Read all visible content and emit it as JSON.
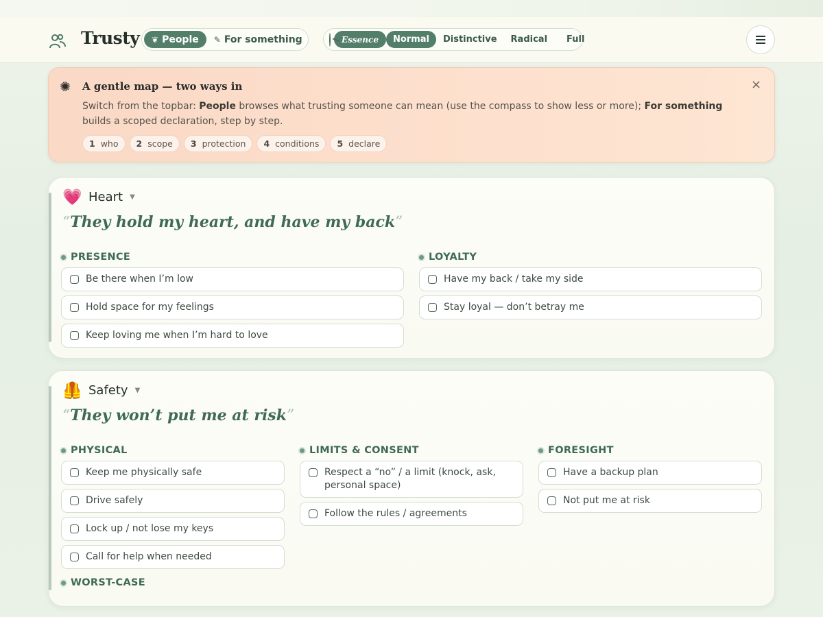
{
  "app": {
    "brand": "Trusty"
  },
  "modes": [
    {
      "label": "People",
      "glyph": "❦",
      "active": true
    },
    {
      "label": "For something",
      "glyph": "✎",
      "active": false
    }
  ],
  "levels": [
    {
      "label": "Essence",
      "active": true,
      "style": "italic"
    },
    {
      "label": "Normal",
      "active": true
    },
    {
      "label": "Distinctive",
      "active": false
    },
    {
      "label": "Radical",
      "active": false
    },
    {
      "label": "Full",
      "active": false
    }
  ],
  "banner": {
    "icon": "✺",
    "title": "A gentle map — two ways in",
    "text_1": "Switch from the topbar: ",
    "bold_1": "People",
    "text_2": " browses what trusting someone can mean (use the compass to show less or more); ",
    "bold_2": "For something",
    "text_3": " builds a scoped declaration, step by step.",
    "close": "×",
    "steps": [
      {
        "num": "1",
        "label": "who"
      },
      {
        "num": "2",
        "label": "scope"
      },
      {
        "num": "3",
        "label": "protection"
      },
      {
        "num": "4",
        "label": "conditions"
      },
      {
        "num": "5",
        "label": "declare"
      }
    ]
  },
  "cards": {
    "heart": {
      "emoji": "💗",
      "name": "Heart",
      "caret": "▼",
      "quote_open": "“",
      "quote": "They hold my heart, and have my back",
      "quote_close": "”",
      "groups": {
        "presence": {
          "label": "PRESENCE",
          "items": [
            "Be there when I’m low",
            "Hold space for my feelings",
            "Keep loving me when I’m hard to love"
          ]
        },
        "loyalty": {
          "label": "LOYALTY",
          "items": [
            "Have my back / take my side",
            "Stay loyal — don’t betray me"
          ]
        }
      }
    },
    "safety": {
      "emoji": "🦺",
      "name": "Safety",
      "caret": "▼",
      "quote_open": "“",
      "quote": "They won’t put me at risk",
      "quote_close": "”",
      "groups": {
        "physical": {
          "label": "PHYSICAL",
          "items": [
            "Keep me physically safe",
            "Drive safely",
            "Lock up / not lose my keys",
            "Call for help when needed"
          ]
        },
        "limits": {
          "label": "LIMITS & CONSENT",
          "items": [
            "Respect a “no” / a limit (knock, ask, personal space)",
            "Follow the rules / agreements"
          ]
        },
        "foresight": {
          "label": "FORESIGHT",
          "items": [
            "Have a backup plan",
            "Not put me at risk"
          ]
        },
        "worstcase": {
          "label": "WORST-CASE"
        }
      }
    }
  }
}
